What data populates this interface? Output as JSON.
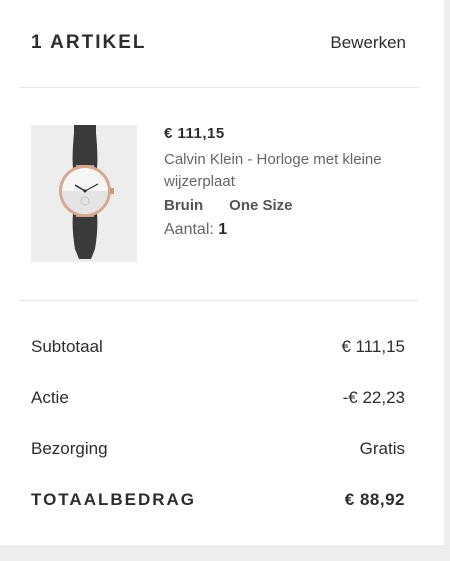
{
  "header": {
    "title": "1 ARTIKEL",
    "edit_label": "Bewerken"
  },
  "item": {
    "price": "€ 111,15",
    "name": "Calvin Klein - Horloge met kleine wijzerplaat",
    "color": "Bruin",
    "size": "One Size",
    "qty_label": "Aantal:",
    "qty_value": "1",
    "image_icon": "watch-image"
  },
  "summary": {
    "subtotal_label": "Subtotaal",
    "subtotal_value": "€ 111,15",
    "discount_label": "Actie",
    "discount_value": "-€ 22,23",
    "shipping_label": "Bezorging",
    "shipping_value": "Gratis",
    "total_label": "TOTAALBEDRAG",
    "total_value": "€ 88,92"
  }
}
